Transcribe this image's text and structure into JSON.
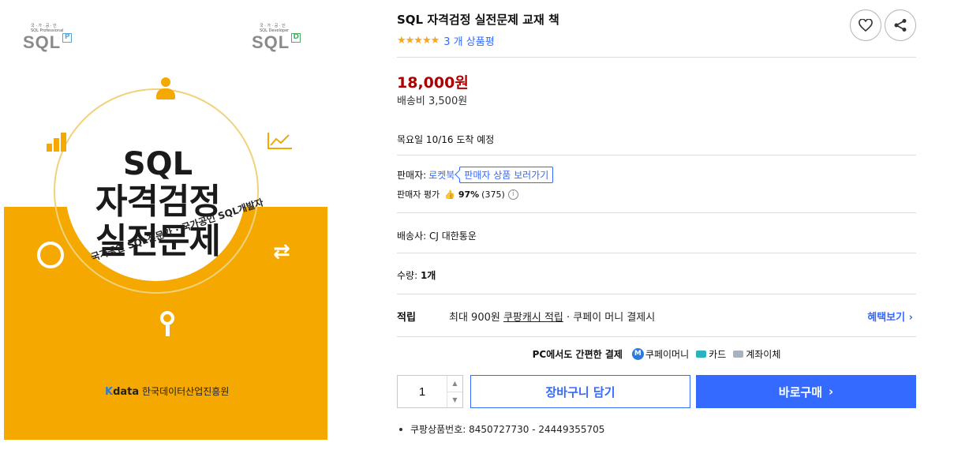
{
  "cover": {
    "logo_pro_small": "국 · 가 · 공 · 인",
    "logo_pro_sub": "SQL Professional",
    "logo_pro_text": "SQL",
    "logo_pro_tag": "P",
    "logo_dev_small": "국 · 가 · 공 · 인",
    "logo_dev_sub": "SQL Developer",
    "logo_dev_text": "SQL",
    "logo_dev_tag": "D",
    "title_line1": "SQL",
    "title_line2": "자격검정",
    "title_line3": "실전문제",
    "subtitle": "국가공인 SQL전문가 · 국가공인 SQL개발자",
    "publisher_brand": "data",
    "publisher_org": "한국데이터산업진흥원"
  },
  "product": {
    "title": "SQL 자격검정 실전문제 교재 책",
    "stars": "★★★★★",
    "review_count_text": "3 개 상품평",
    "price": "18,000원",
    "shipping_fee": "배송비 3,500원",
    "arrival": "목요일 10/16 도착 예정",
    "seller_label": "판매자:",
    "seller_name": "로켓북",
    "seller_link": "판매자 상품 보러가기",
    "seller_eval_label": "판매자 평가",
    "seller_eval_pct": "97%",
    "seller_eval_count": "(375)",
    "courier": "배송사:  CJ 대한통운",
    "quantity_label": "수량:",
    "quantity_value": "1개"
  },
  "reward": {
    "label": "적립",
    "text_prefix": "최대 900원",
    "text_link": "쿠팡캐시 적립",
    "text_suffix": "· 쿠페이 머니 결제시",
    "benefit_link": "혜택보기 ›"
  },
  "payment": {
    "lead": "PC에서도 간편한 결제",
    "coupay": "쿠페이머니",
    "card": "카드",
    "account": "계좌이체"
  },
  "purchase": {
    "quantity_input": "1",
    "cart_button": "장바구니 담기",
    "buy_button": "바로구매",
    "buy_chevron": "›"
  },
  "product_id": "쿠팡상품번호: 8450727730 - 24449355705",
  "colors": {
    "accent_blue": "#346aff",
    "price_red": "#ae0000",
    "star_orange": "#f5a623",
    "cover_yellow": "#f5a800"
  },
  "icons": {
    "favorite": "heart-icon",
    "share": "share-icon",
    "thumb": "thumbs-up-icon",
    "info": "info-icon"
  }
}
